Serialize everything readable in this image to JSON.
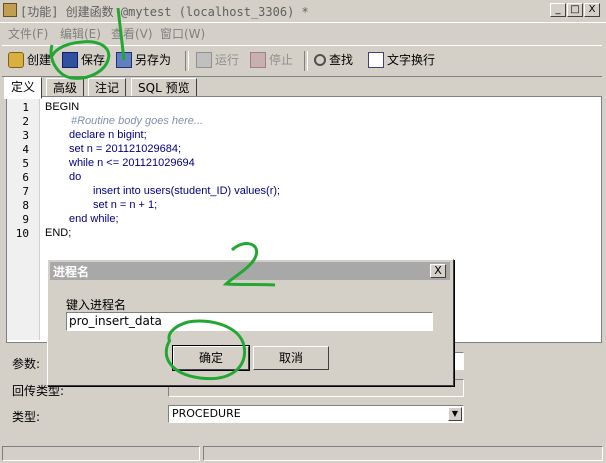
{
  "window": {
    "title": "[功能] 创建函数 @mytest (localhost_3306) *",
    "min_label": "_",
    "max_label": "□",
    "close_label": "X"
  },
  "menu": {
    "items": [
      "文件(F)",
      "编辑(E)",
      "查看(V)",
      "窗口(W)"
    ]
  },
  "toolbar": {
    "create_label": "创建",
    "save_label": "保存",
    "save_as_label": "另存为",
    "run_label": "运行",
    "stop_label": "停止",
    "find_label": "查找",
    "wrap_label": "文字换行"
  },
  "tabs": [
    "定义",
    "高级",
    "注记",
    "SQL 预览"
  ],
  "editor": {
    "line_numbers": [
      "1",
      "2",
      "3",
      "4",
      "5",
      "6",
      "7",
      "8",
      "9",
      "10"
    ],
    "lines": [
      "BEGIN",
      "#Routine body goes here...",
      "declare n bigint;",
      "set n = 201121029684;",
      "while n <= 201121029694",
      "do",
      "insert into users(student_ID) values(r);",
      "set n = n + 1;",
      "end while;",
      "END;"
    ]
  },
  "properties": {
    "params_label": "参数:",
    "return_type_label": "回传类型:",
    "type_label": "类型:",
    "type_value": "PROCEDURE"
  },
  "dialog": {
    "title": "进程名",
    "close_label": "X",
    "prompt": "键入进程名",
    "input_value": "pro_insert_data",
    "ok_label": "确定",
    "cancel_label": "取消"
  },
  "annotations": {
    "color": "#22a832",
    "label_1": "1",
    "label_2": "2"
  }
}
